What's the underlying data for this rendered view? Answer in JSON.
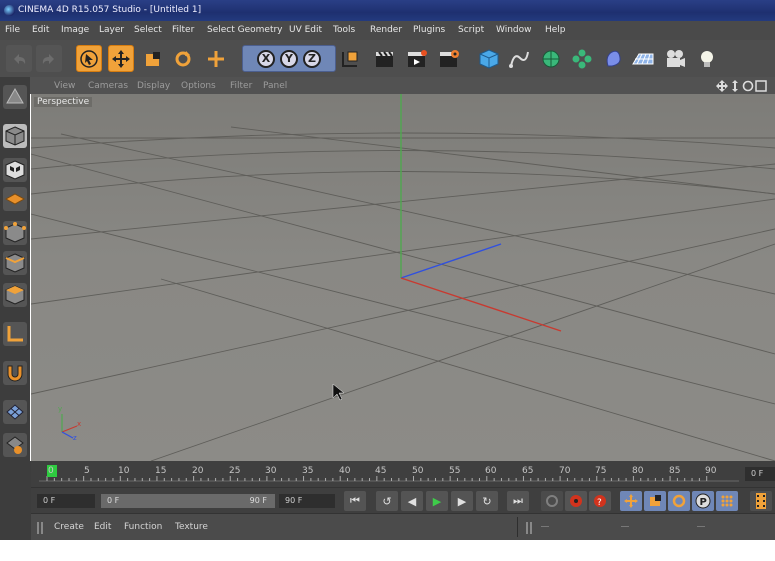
{
  "window": {
    "title": "CINEMA 4D R15.057 Studio - [Untitled 1]"
  },
  "menubar": {
    "items": [
      "File",
      "Edit",
      "Image",
      "Layer",
      "Select",
      "Filter",
      "Select Geometry",
      "UV Edit",
      "Tools",
      "Render",
      "Plugins",
      "Script",
      "Window",
      "Help"
    ]
  },
  "toolbar": {
    "axis_x": "X",
    "axis_y": "Y",
    "axis_z": "Z"
  },
  "viewport": {
    "menu": [
      "View",
      "Cameras",
      "Display",
      "Options",
      "Filter",
      "Panel"
    ],
    "label": "Perspective",
    "axis_gizmo": {
      "y": "y",
      "x": "x",
      "z": "z"
    }
  },
  "timeline": {
    "ticks": [
      "0",
      "5",
      "10",
      "15",
      "20",
      "25",
      "30",
      "35",
      "40",
      "45",
      "50",
      "55",
      "60",
      "65",
      "70",
      "75",
      "80",
      "85",
      "90"
    ],
    "end_frame": "0 F"
  },
  "transport": {
    "start_frame": "0 F",
    "range_start": "0 F",
    "range_end": "90 F",
    "end_frame": "90 F"
  },
  "material_manager": {
    "menu": [
      "Create",
      "Edit",
      "Function",
      "Texture"
    ]
  },
  "colors": {
    "active_tool": "#f0a23a",
    "x_axis": "#c0392b",
    "y_axis": "#27ae60",
    "z_axis": "#2e5bd8"
  }
}
